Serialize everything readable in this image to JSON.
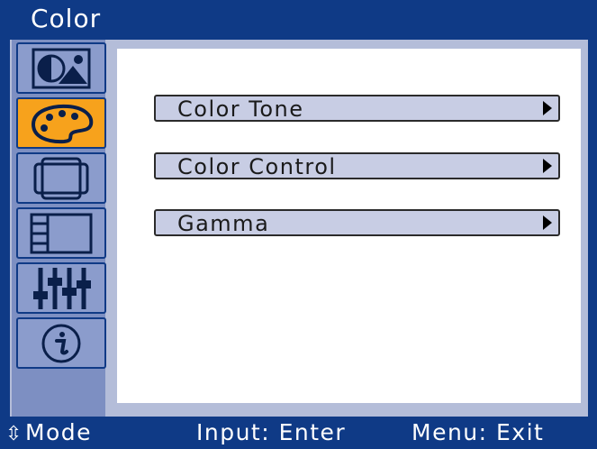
{
  "window": {
    "title": "Color"
  },
  "sidebar": {
    "items": [
      {
        "icon": "picture-icon",
        "selected": false
      },
      {
        "icon": "palette-icon",
        "selected": true
      },
      {
        "icon": "screen-geometry-icon",
        "selected": false
      },
      {
        "icon": "window-layout-icon",
        "selected": false
      },
      {
        "icon": "sliders-icon",
        "selected": false
      },
      {
        "icon": "info-icon",
        "selected": false
      }
    ]
  },
  "menu": {
    "items": [
      {
        "label": "Color Tone"
      },
      {
        "label": "Color Control"
      },
      {
        "label": "Gamma"
      }
    ]
  },
  "footer": {
    "mode": "⭘Mode",
    "mode_text": "Mode",
    "input": "Input: Enter",
    "menu": "Menu: Exit"
  },
  "colors": {
    "frame": "#0f3a86",
    "panel": "#b4bdd9",
    "sidebar": "#7d8fc2",
    "selected_tile": "#f7a21c",
    "menu_item": "#c8cde4"
  }
}
